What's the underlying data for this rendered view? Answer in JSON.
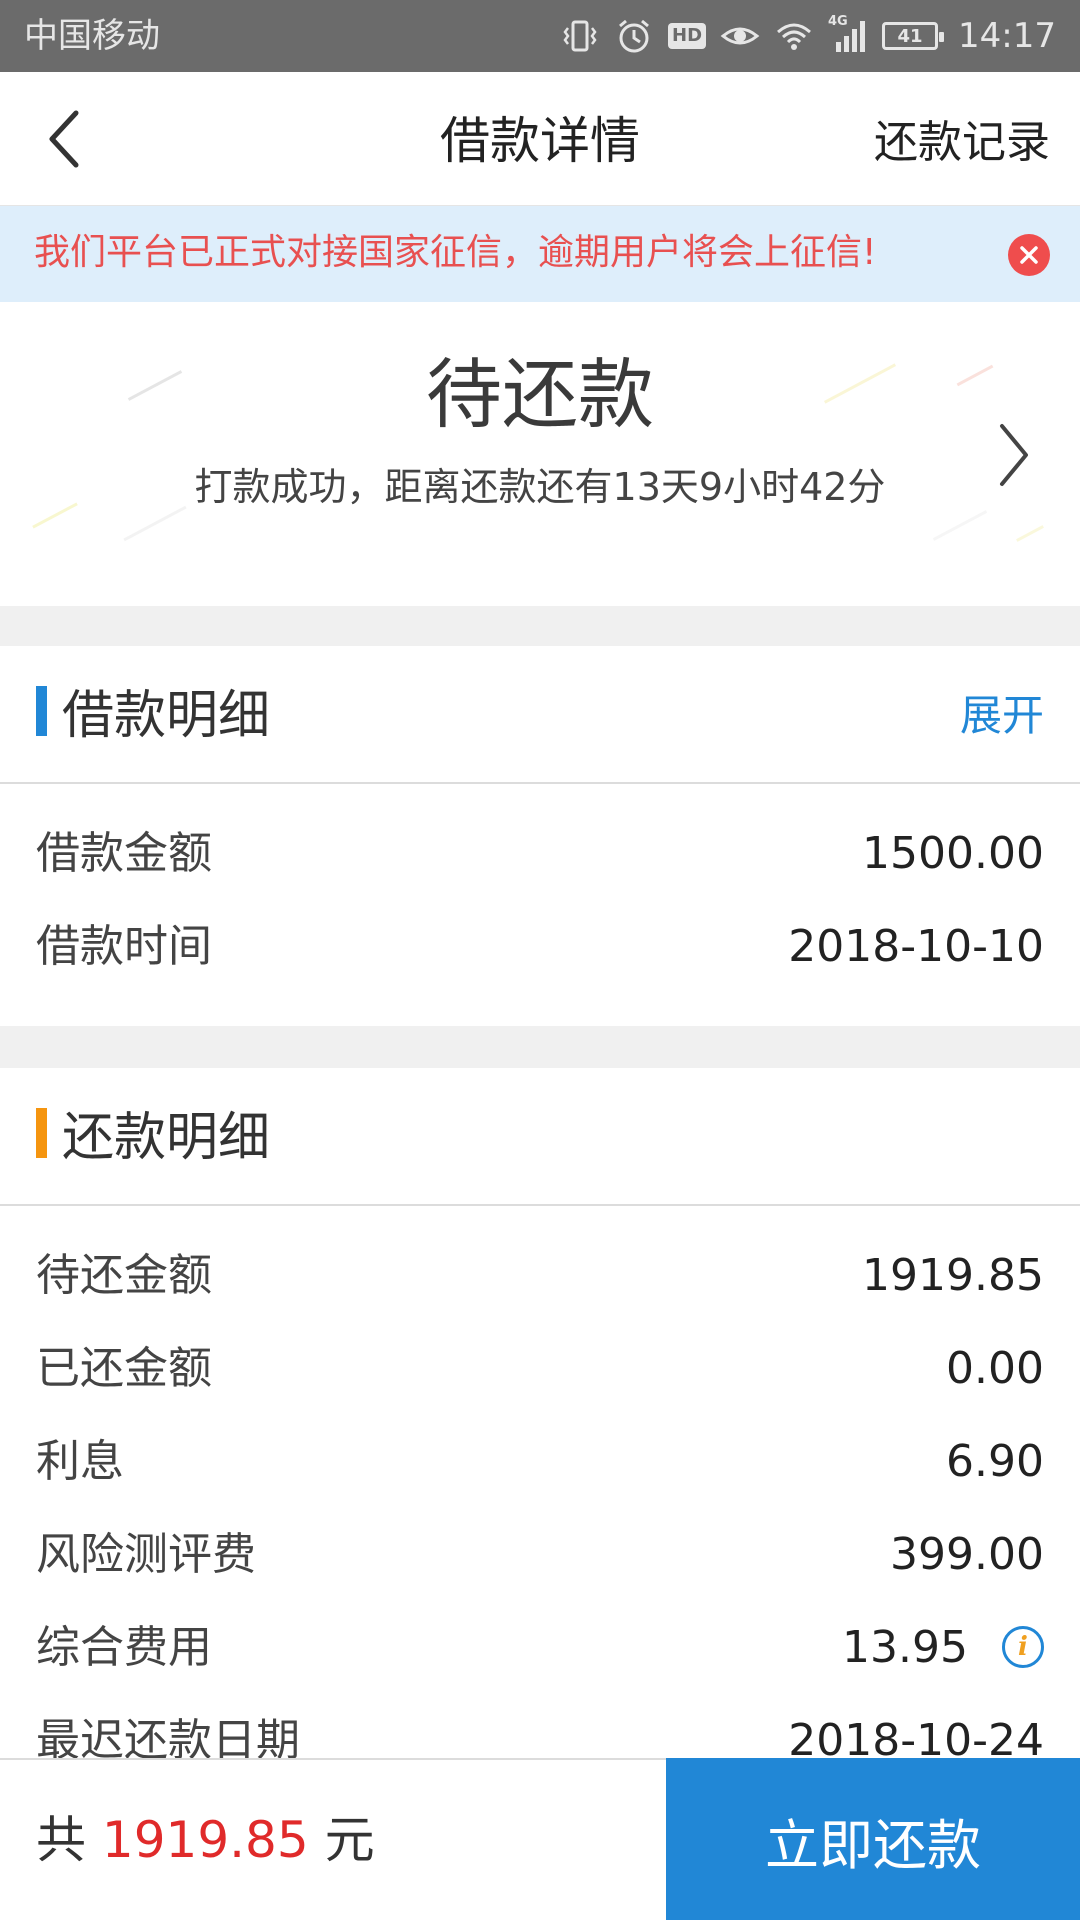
{
  "status_bar": {
    "carrier": "中国移动",
    "hd": "HD",
    "network": "4G",
    "battery": "41",
    "time": "14:17",
    "icons": [
      "vibrate-icon",
      "alarm-icon",
      "hd-icon",
      "eye-icon",
      "wifi-icon",
      "signal-icon",
      "battery-icon"
    ]
  },
  "header": {
    "back_icon": "chevron-left-icon",
    "title": "借款详情",
    "right_link": "还款记录"
  },
  "notice": {
    "text": "我们平台已正式对接国家征信，逾期用户将会上征信!",
    "close_icon": "close-icon",
    "text_color": "#e85050",
    "background": "#deeefb"
  },
  "status_card": {
    "title": "待还款",
    "subtitle": "打款成功，距离还款还有13天9小时42分",
    "chevron_icon": "chevron-right-icon"
  },
  "loan_detail": {
    "title": "借款明细",
    "bar_color": "#2187d6",
    "action": "展开",
    "rows": [
      {
        "label": "借款金额",
        "value": "1500.00"
      },
      {
        "label": "借款时间",
        "value": "2018-10-10"
      }
    ]
  },
  "repay_detail": {
    "title": "还款明细",
    "bar_color": "#f5950f",
    "rows": [
      {
        "label": "待还金额",
        "value": "1919.85"
      },
      {
        "label": "已还金额",
        "value": "0.00"
      },
      {
        "label": "利息",
        "value": "6.90"
      },
      {
        "label": "风险测评费",
        "value": "399.00"
      },
      {
        "label": "综合费用",
        "value": "13.95",
        "icon": "info-icon"
      },
      {
        "label": "最迟还款日期",
        "value": "2018-10-24"
      }
    ]
  },
  "bottom_bar": {
    "prefix": "共",
    "amount": "1919.85",
    "suffix": "元",
    "amount_color": "#e02a2a",
    "pay_button": "立即还款",
    "button_color": "#2187d6"
  }
}
